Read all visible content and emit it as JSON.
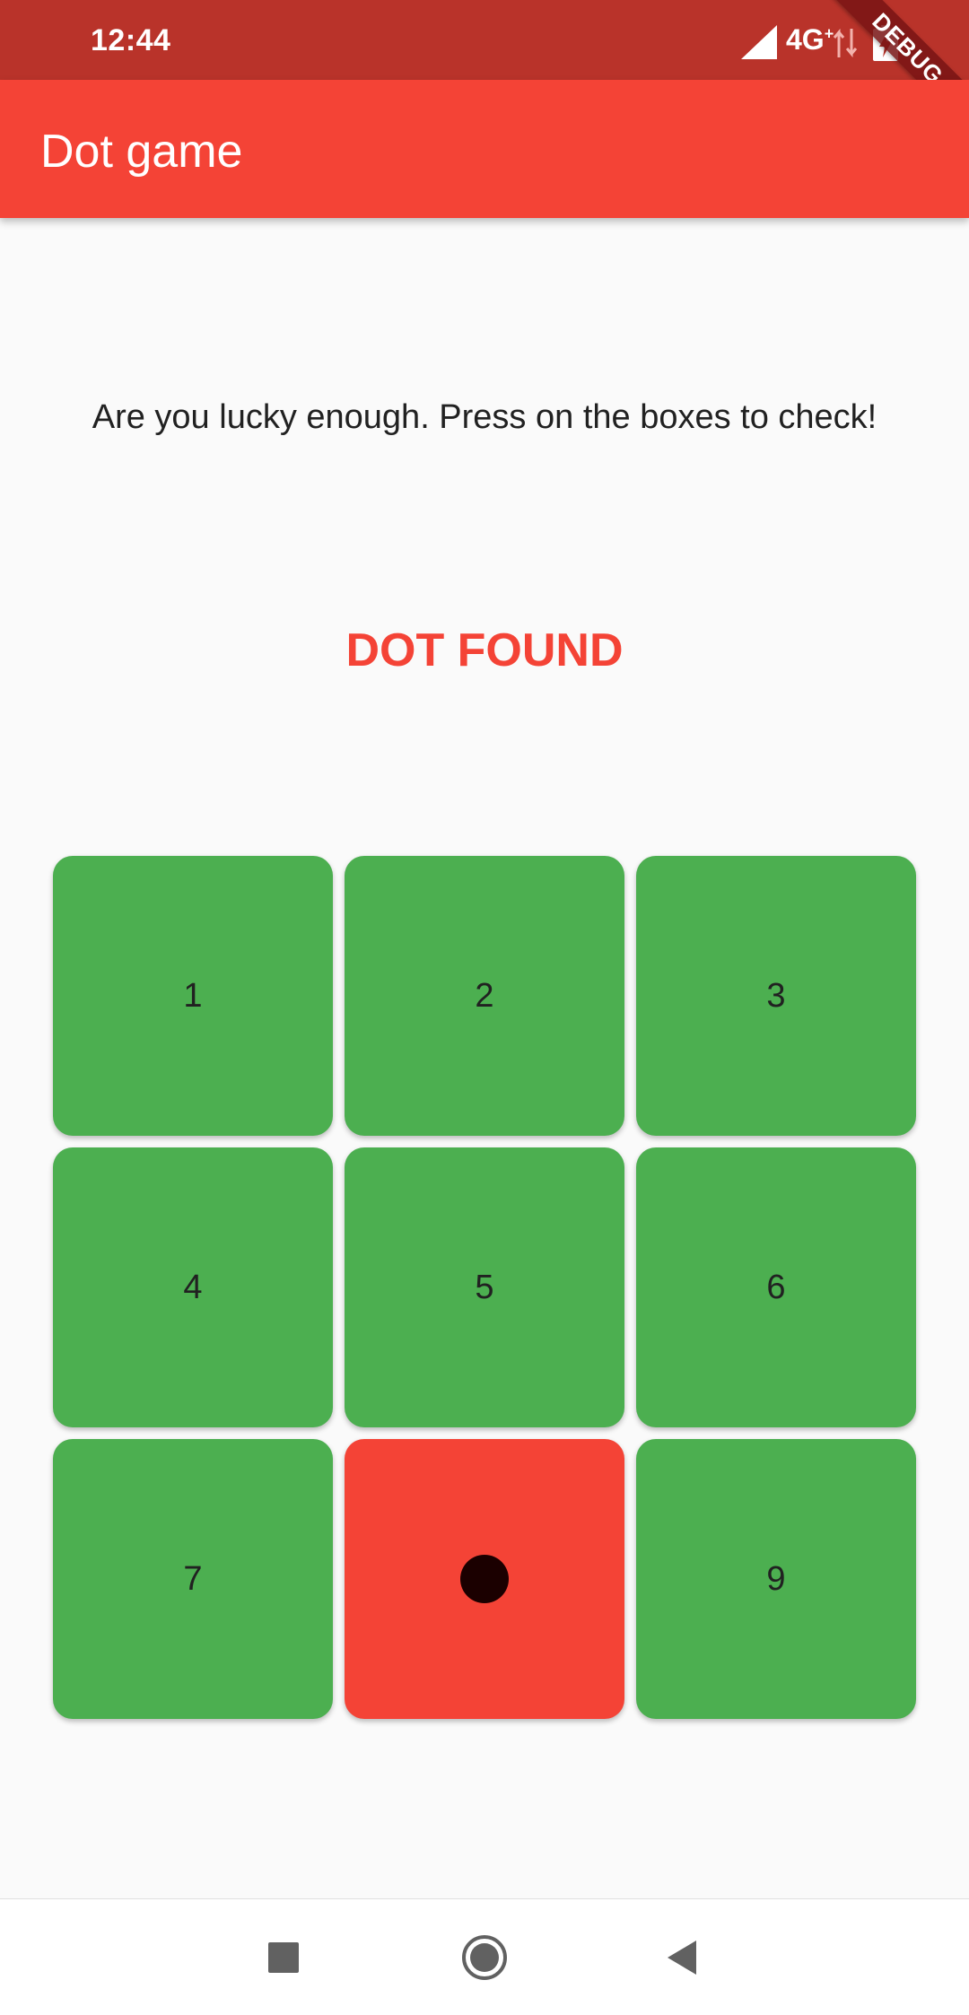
{
  "status_bar": {
    "time": "12:44",
    "network": "4G",
    "network_sup": "+",
    "debug_banner": "DEBUG",
    "icons": [
      "signal-icon",
      "data-arrows-icon",
      "battery-charging-icon"
    ]
  },
  "app_bar": {
    "title": "Dot game",
    "color": "#F44336"
  },
  "content": {
    "prompt": "Are you lucky enough. Press on the boxes to check!",
    "result": "DOT FOUND",
    "result_color": "#F44336"
  },
  "grid": {
    "boxes": [
      {
        "label": "1",
        "state": "green"
      },
      {
        "label": "2",
        "state": "green"
      },
      {
        "label": "3",
        "state": "green"
      },
      {
        "label": "4",
        "state": "green"
      },
      {
        "label": "5",
        "state": "green"
      },
      {
        "label": "6",
        "state": "green"
      },
      {
        "label": "7",
        "state": "green"
      },
      {
        "label": "",
        "state": "dot"
      },
      {
        "label": "9",
        "state": "green"
      }
    ],
    "colors": {
      "green": "#4CAF50",
      "red": "#F44336",
      "dot": "#1B0000"
    }
  },
  "nav_bar": {
    "buttons": [
      "recents-square-icon",
      "home-circle-icon",
      "back-triangle-icon"
    ]
  }
}
